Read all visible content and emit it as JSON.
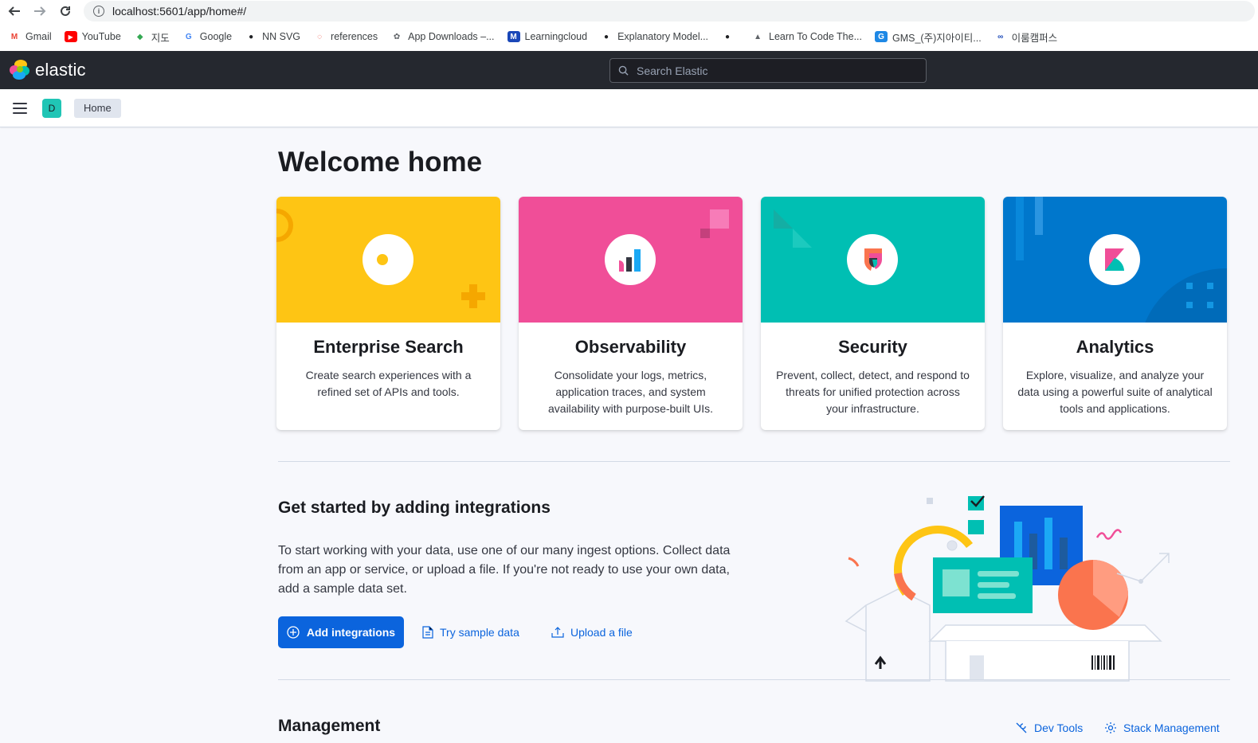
{
  "browser": {
    "url": "localhost:5601/app/home#/",
    "bookmarks": [
      {
        "label": "Gmail",
        "icon": "gmail-icon",
        "color": "#ea4335"
      },
      {
        "label": "YouTube",
        "icon": "youtube-icon",
        "color": "#ff0000"
      },
      {
        "label": "지도",
        "icon": "maps-icon",
        "color": "#34a853"
      },
      {
        "label": "Google",
        "icon": "google-icon",
        "color": "#4285f4"
      },
      {
        "label": "NN SVG",
        "icon": "globe-icon",
        "color": "#202124"
      },
      {
        "label": "references",
        "icon": "power-icon",
        "color": "#ea4335"
      },
      {
        "label": "App Downloads –...",
        "icon": "flower-icon",
        "color": "#5f6368"
      },
      {
        "label": "Learningcloud",
        "icon": "m-icon",
        "color": "#1a47b8"
      },
      {
        "label": "Explanatory Model...",
        "icon": "globe-icon",
        "color": "#202124"
      },
      {
        "label": "",
        "icon": "globe-icon",
        "color": "#202124"
      },
      {
        "label": "Learn To Code The...",
        "icon": "graduation-cap-icon",
        "color": "#5f6368"
      },
      {
        "label": "GMS_(주)지아이티...",
        "icon": "g-icon",
        "color": "#1e88e5"
      },
      {
        "label": "이룸캠퍼스",
        "icon": "link-icon",
        "color": "#1a47b8"
      }
    ]
  },
  "header": {
    "logo_text": "elastic",
    "search_placeholder": "Search Elastic",
    "space_initial": "D",
    "breadcrumb": "Home"
  },
  "main": {
    "title": "Welcome home",
    "cards": [
      {
        "title": "Enterprise Search",
        "description": "Create search experiences with a refined set of APIs and tools.",
        "color": "#fec514"
      },
      {
        "title": "Observability",
        "description": "Consolidate your logs, metrics, application traces, and system availability with purpose-built UIs.",
        "color": "#f04e98"
      },
      {
        "title": "Security",
        "description": "Prevent, collect, detect, and respond to threats for unified protection across your infrastructure.",
        "color": "#00bfb3"
      },
      {
        "title": "Analytics",
        "description": "Explore, visualize, and analyze your data using a powerful suite of analytical tools and applications.",
        "color": "#0077cc"
      }
    ],
    "integrations": {
      "title": "Get started by adding integrations",
      "text": "To start working with your data, use one of our many ingest options. Collect data from an app or service, or upload a file. If you're not ready to use your own data, add a sample data set.",
      "add_button": "Add integrations",
      "sample_link": "Try sample data",
      "upload_link": "Upload a file"
    },
    "management": {
      "title": "Management",
      "dev_tools": "Dev Tools",
      "stack_management": "Stack Management"
    }
  }
}
